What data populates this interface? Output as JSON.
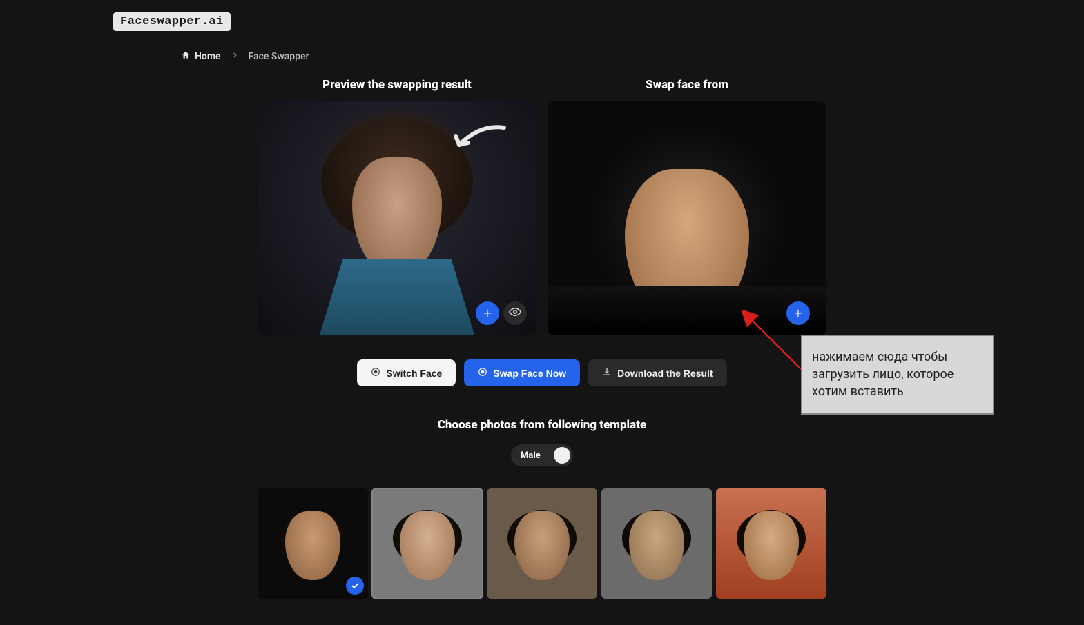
{
  "logo": "Faceswapper.ai",
  "breadcrumb": {
    "home": "Home",
    "current": "Face Swapper"
  },
  "panels": {
    "left_title": "Preview the swapping result",
    "right_title": "Swap face from"
  },
  "actions": {
    "switch": "Switch Face",
    "swap_now": "Swap Face Now",
    "download": "Download the Result"
  },
  "templates": {
    "title": "Choose photos from following template",
    "toggle_label": "Male"
  },
  "annotation": {
    "text": "нажимаем сюда чтобы загрузить лицо, которое хотим вставить"
  }
}
